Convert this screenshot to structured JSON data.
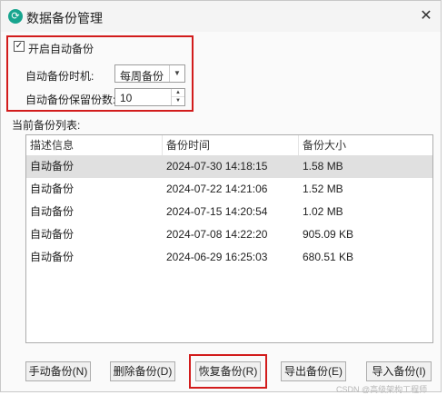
{
  "window": {
    "title": "数据备份管理",
    "close_glyph": "✕"
  },
  "settings": {
    "auto_backup_checked": true,
    "auto_backup_label": "开启自动备份",
    "timing_label": "自动备份时机:",
    "timing_value": "每周备份",
    "retain_label": "自动备份保留份数:",
    "retain_value": "10"
  },
  "list": {
    "caption": "当前备份列表:",
    "columns": [
      "描述信息",
      "备份时间",
      "备份大小"
    ],
    "rows": [
      {
        "desc": "自动备份",
        "time": "2024-07-30 14:18:15",
        "size": "1.58 MB",
        "selected": true
      },
      {
        "desc": "自动备份",
        "time": "2024-07-22 14:21:06",
        "size": "1.52 MB",
        "selected": false
      },
      {
        "desc": "自动备份",
        "time": "2024-07-15 14:20:54",
        "size": "1.02 MB",
        "selected": false
      },
      {
        "desc": "自动备份",
        "time": "2024-07-08 14:22:20",
        "size": "905.09 KB",
        "selected": false
      },
      {
        "desc": "自动备份",
        "time": "2024-06-29 16:25:03",
        "size": "680.51 KB",
        "selected": false
      }
    ]
  },
  "buttons": {
    "manual": "手动备份(N)",
    "delete": "删除备份(D)",
    "restore": "恢复备份(R)",
    "export": "导出备份(E)",
    "import": "导入备份(I)"
  },
  "watermark": "CSDN @高级架构工程师",
  "colors": {
    "highlight_box": "#d21c1c",
    "app_icon": "#18a58f",
    "selected_row": "#e0e0e0"
  },
  "icons": {
    "app": "app-logo-icon",
    "close": "close-icon",
    "check": "checkmark-icon",
    "dropdown": "chevron-down-icon"
  }
}
